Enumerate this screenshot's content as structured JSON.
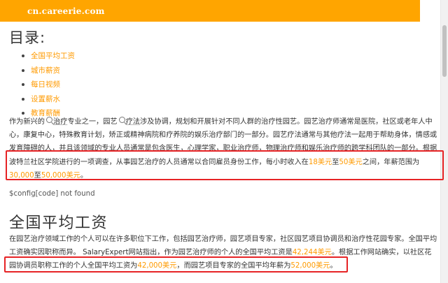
{
  "header": {
    "site_name": "cn.careerie.com"
  },
  "toc": {
    "title": "目录:",
    "items": [
      {
        "label": "全国平均工资"
      },
      {
        "label": "城市薪资"
      },
      {
        "label": "每日视频"
      },
      {
        "label": "设置薪水"
      },
      {
        "label": "教育薪酬"
      }
    ]
  },
  "intro": {
    "t1": "作为新兴的",
    "link_treatment": "治疗",
    "t2": "专业之一，园艺",
    "link_therapy": "疗法",
    "t3": "涉及协调，规划和开展针对不同人群的治疗性园艺。园艺治疗师通常是医院，社区或老年人中心，康复中心，特殊教育计划，矫正或精神病院和疗养院的娱乐治疗部门的一部分。园艺疗法通常与其他疗法一起用于帮助身体，情感或发育障碍的人，并且该领域的专业人员通常是包含医生，心理学家，职业治疗师，物理治疗师和娱乐治疗师的跨学科团队的一部分。",
    "t4": "根据波特兰社区学院进行的一项调查，从事园艺治疗的人员通常以合同雇员身份工作，每小时收入在",
    "hourly_low": "18美元",
    "t5": "至",
    "hourly_high": "50美元",
    "t6": "之间，年薪范围为",
    "annual_low": "30,000",
    "t7": "至",
    "annual_high": "50,000美元",
    "t8": "。"
  },
  "config_note": "$config[code] not found",
  "section": {
    "heading": "全国平均工资",
    "t1": "在园艺治疗领域工作的个人可以在许多职位下工作，包括园艺治疗师，园艺项目专家，社区园艺项目协调员和治疗性花园专家。全国平均工资确实因职称而异。 SalaryExpert网站指出，作为园艺治疗师的个人的全国平均工资是",
    "salary_therapist": "42,244美元",
    "t2": "。根据工作网站确实，以社区花园协调员职称工作的个人全国平均工资为",
    "salary_coordinator": "42,000美元",
    "t3": "，而园艺项目专家的全国平均年薪为",
    "salary_specialist": "52,000美元",
    "t4": "。"
  },
  "colors": {
    "brand": "#ffa500",
    "link": "#ff9a00",
    "highlight_box": "#e62325"
  }
}
